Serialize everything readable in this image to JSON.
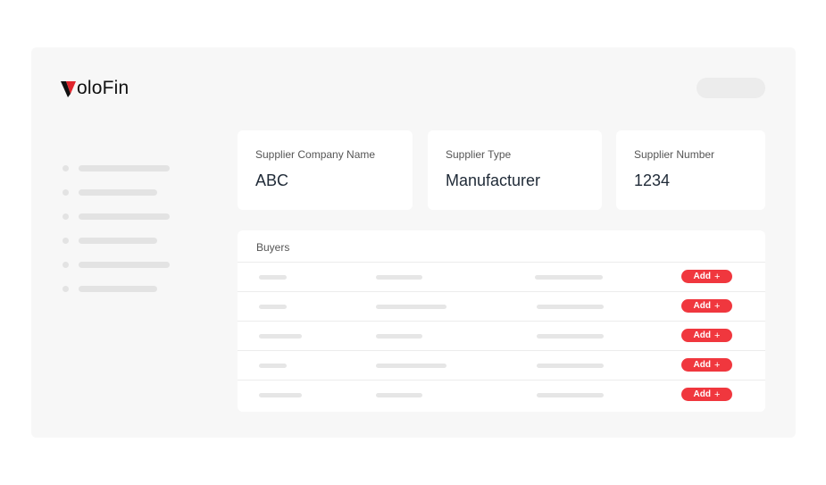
{
  "brand": {
    "logo_text": "oloFin",
    "logo_initial": "V",
    "accent": "#f0373e"
  },
  "cards": [
    {
      "label": "Supplier Company Name",
      "value": "ABC"
    },
    {
      "label": "Supplier Type",
      "value": "Manufacturer"
    },
    {
      "label": "Supplier Number",
      "value": "1234"
    }
  ],
  "buyers": {
    "title": "Buyers",
    "rows": [
      {
        "action_label": "Add",
        "action_icon": "+"
      },
      {
        "action_label": "Add",
        "action_icon": "+"
      },
      {
        "action_label": "Add",
        "action_icon": "+"
      },
      {
        "action_label": "Add",
        "action_icon": "+"
      },
      {
        "action_label": "Add",
        "action_icon": "+"
      }
    ]
  }
}
